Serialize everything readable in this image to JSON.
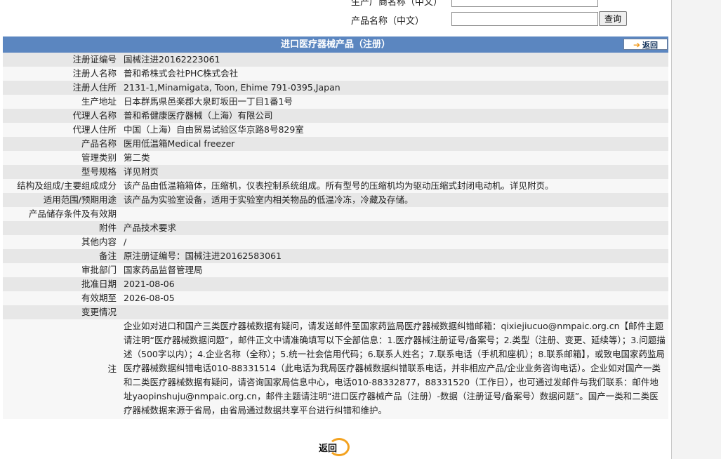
{
  "search": {
    "company_label": "生产厂商名称（中文）",
    "product_label": "产品名称（中文）",
    "company_value": "",
    "product_value": "",
    "query_button": "查询"
  },
  "panel": {
    "title": "进口医疗器械产品（注册）",
    "back_top": "返回"
  },
  "rows": [
    {
      "key": "注册证编号",
      "value": "国械注进20162223061"
    },
    {
      "key": "注册人名称",
      "value": "普和希株式会社PHC株式会社"
    },
    {
      "key": "注册人住所",
      "value": "2131-1,Minamigata, Toon, Ehime 791-0395,Japan"
    },
    {
      "key": "生产地址",
      "value": "日本群馬県邑楽郡大泉町坂田一丁目1番1号"
    },
    {
      "key": "代理人名称",
      "value": "普和希健康医疗器械（上海）有限公司"
    },
    {
      "key": "代理人住所",
      "value": "中国（上海）自由贸易试验区华京路8号829室"
    },
    {
      "key": "产品名称",
      "value": "医用低温箱Medical freezer"
    },
    {
      "key": "管理类别",
      "value": "第二类"
    },
    {
      "key": "型号规格",
      "value": "详见附页"
    },
    {
      "key": "结构及组成/主要组成成分",
      "value": "该产品由低温箱箱体，压缩机，仪表控制系统组成。所有型号的压缩机均为驱动压缩式封闭电动机。详见附页。"
    },
    {
      "key": "适用范围/预期用途",
      "value": "该产品为实验室设备，适用于实验室内相关物品的低温冷冻，冷藏及存储。"
    },
    {
      "key": "产品储存条件及有效期",
      "value": ""
    },
    {
      "key": "附件",
      "value": "产品技术要求"
    },
    {
      "key": "其他内容",
      "value": "/"
    },
    {
      "key": "备注",
      "value": "原注册证编号：国械注进20162583061"
    },
    {
      "key": "审批部门",
      "value": "国家药品监督管理局"
    },
    {
      "key": "批准日期",
      "value": "2021-08-06"
    },
    {
      "key": "有效期至",
      "value": "2026-08-05"
    },
    {
      "key": "变更情况",
      "value": ""
    }
  ],
  "notice": {
    "key": "注",
    "text": "企业如对进口和国产三类医疗器械数据有疑问，请发送邮件至国家药监局医疗器械数据纠错邮箱：qixiejiucuo@nmpaic.org.cn【邮件主题请注明“医疗器械数据问题”，邮件正文中请准确填写以下全部信息：1.医疗器械注册证号/备案号；2.类型（注册、变更、延续等）；3.问题描述（500字以内）；4.企业名称（全称）；5.统一社会信用代码；6.联系人姓名；7.联系电话（手机和座机）；8.联系邮箱】，或致电国家药监局医疗器械数据纠错电话010-88331514（此电话为我局医疗器械数据纠错联系电话，并非相应产品/企业业务咨询电话）。企业如对国产一类和二类医疗器械数据有疑问，请咨询国家局信息中心，电话010-88332877，88331520（工作日），也可通过发邮件与我们联系：邮件地址yaopinshuju@nmpaic.org.cn，邮件主题请注明“进口医疗器械产品（注册）-数据（注册证号/备案号）数据问题”。国产一类和二类医疗器械数据来源于省局，由省局通过数据共享平台进行纠错和维护。"
  },
  "bottom_back": "返回"
}
